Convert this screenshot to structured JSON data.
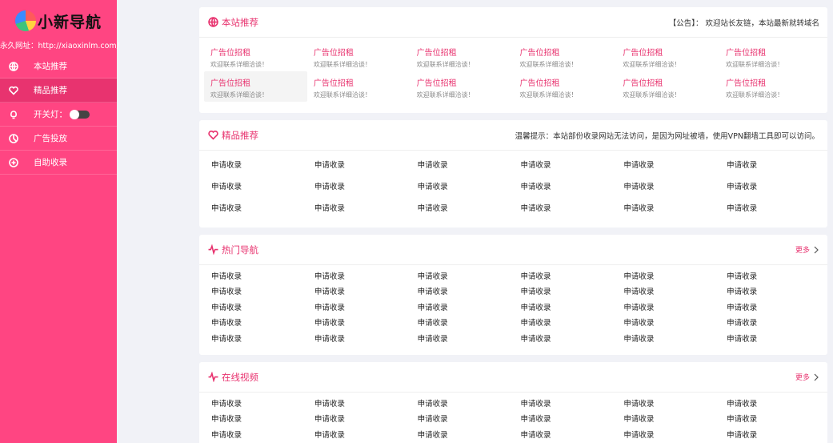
{
  "brand": {
    "name": "小新导航",
    "permalink": "永久网址：http://xiaoxinlm.com/"
  },
  "sidebar": {
    "items": [
      {
        "label": "本站推荐",
        "icon": "globe-icon"
      },
      {
        "label": "精品推荐",
        "icon": "heart-icon"
      },
      {
        "label": "开关灯：",
        "icon": "bulb-icon"
      },
      {
        "label": "广告投放",
        "icon": "pie-icon"
      },
      {
        "label": "自助收录",
        "icon": "plus-circle-icon"
      }
    ]
  },
  "recommend": {
    "title": "本站推荐",
    "notice": "【公告】：  欢迎站长友链，本站最新就转域名",
    "ads": [
      {
        "title": "广告位招租",
        "sub": "欢迎联系详细洽谈！"
      },
      {
        "title": "广告位招租",
        "sub": "欢迎联系详细洽谈！"
      },
      {
        "title": "广告位招租",
        "sub": "欢迎联系详细洽谈！"
      },
      {
        "title": "广告位招租",
        "sub": "欢迎联系详细洽谈！"
      },
      {
        "title": "广告位招租",
        "sub": "欢迎联系详细洽谈！"
      },
      {
        "title": "广告位招租",
        "sub": "欢迎联系详细洽谈！"
      },
      {
        "title": "广告位招租",
        "sub": "欢迎联系详细洽谈！"
      },
      {
        "title": "广告位招租",
        "sub": "欢迎联系详细洽谈！"
      },
      {
        "title": "广告位招租",
        "sub": "欢迎联系详细洽谈！"
      },
      {
        "title": "广告位招租",
        "sub": "欢迎联系详细洽谈！"
      },
      {
        "title": "广告位招租",
        "sub": "欢迎联系详细洽谈！"
      },
      {
        "title": "广告位招租",
        "sub": "欢迎联系详细洽谈！"
      }
    ]
  },
  "featured": {
    "title": "精品推荐",
    "notice": "温馨提示：本站部份收录网站无法访问，是因为网址被墙，使用VPN翻墙工具即可以访问。",
    "link_label": "申请收录",
    "count": 18
  },
  "hot": {
    "title": "热门导航",
    "more": "更多",
    "link_label": "申请收录",
    "count": 30
  },
  "video": {
    "title": "在线视频",
    "more": "更多",
    "link_label": "申请收录",
    "count": 18
  }
}
